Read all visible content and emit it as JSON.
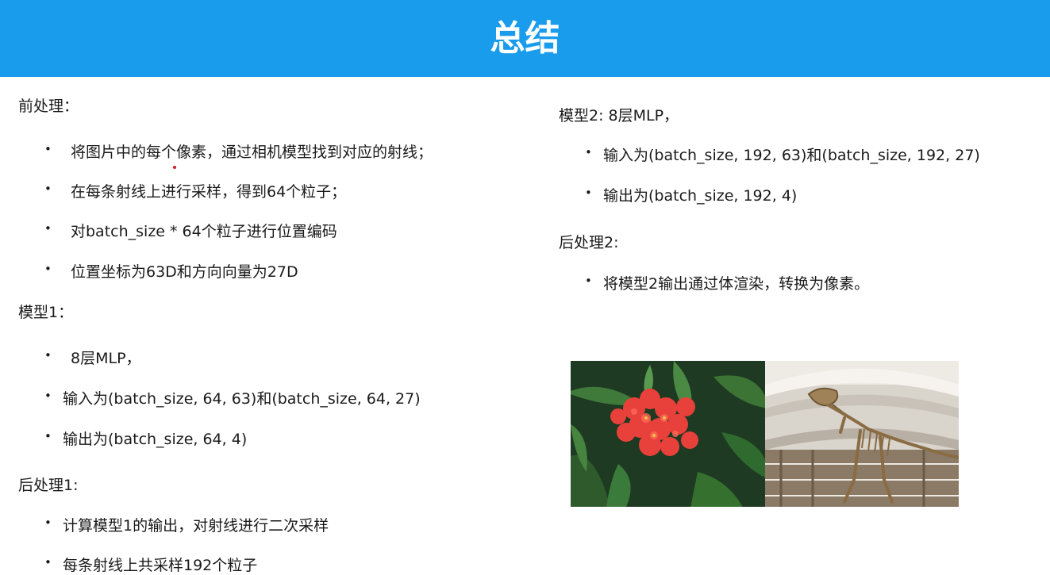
{
  "header": {
    "title": "总结"
  },
  "left": {
    "sections": [
      {
        "heading": "前处理：",
        "items": [
          "将图片中的每个像素，通过相机模型找到对应的射线；",
          "在每条射线上进行采样，得到64个粒子；",
          "对batch_size * 64个粒子进行位置编码",
          "位置坐标为63D和方向向量为27D"
        ]
      },
      {
        "heading": "模型1：",
        "items": [
          "8层MLP，",
          "输入为(batch_size, 64, 63)和(batch_size, 64, 27)",
          "输出为(batch_size, 64, 4)"
        ]
      },
      {
        "heading": "后处理1:",
        "items": [
          "计算模型1的输出，对射线进行二次采样",
          "每条射线上共采样192个粒子"
        ]
      }
    ]
  },
  "right": {
    "sections": [
      {
        "heading": "模型2: 8层MLP，",
        "items": [
          "输入为(batch_size, 192, 63)和(batch_size, 192, 27)",
          "输出为(batch_size, 192, 4)"
        ]
      },
      {
        "heading": "后处理2:",
        "items": [
          "将模型2输出通过体渲染，转换为像素。"
        ]
      }
    ]
  },
  "colors": {
    "header_bg": "#1a9cec",
    "header_text": "#ffffff",
    "body_text": "#1a1a1a"
  }
}
